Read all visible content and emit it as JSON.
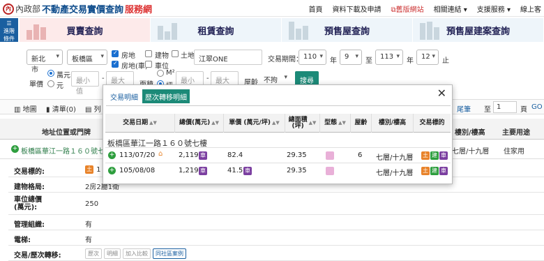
{
  "header": {
    "seal": "內",
    "ministry": "內政部",
    "title_part1": "不動產交易實價查詢",
    "title_part2": "服務網",
    "nav": [
      "首頁",
      "資料下載及申請",
      "舊版網站",
      "相關連結",
      "支援服務",
      "線上客"
    ]
  },
  "side_button": {
    "line1": "進階",
    "line2": "條件"
  },
  "tabs": [
    "買賣查詢",
    "租賃查詢",
    "預售屋查詢",
    "預售屋建案查詢"
  ],
  "search": {
    "city": "新北市",
    "district": "板橋區",
    "checkboxes": [
      {
        "label": "房地",
        "checked": true
      },
      {
        "label": "建物",
        "checked": false
      },
      {
        "label": "土地",
        "checked": false
      },
      {
        "label": "房地(車)",
        "checked": true
      },
      {
        "label": "車位",
        "checked": false
      }
    ],
    "keyword": "江翠ONE",
    "period_label": "交易期間：",
    "year_from": "110",
    "month_from": "9",
    "year_to": "113",
    "month_to": "12",
    "year_unit": "年",
    "to_label": "至",
    "end_label": "止",
    "price_label": "單價",
    "price_unit_options": [
      "萬元",
      "元"
    ],
    "min_placeholder": "最小值",
    "max_placeholder": "最大值",
    "area_label": "面積",
    "area_unit_options": [
      "M²",
      "坪"
    ],
    "age_label": "屋齡",
    "age_value": "不拘",
    "search_button": "搜尋"
  },
  "toolbar": {
    "map": "地圖",
    "list": "清單(0)",
    "print": "列",
    "last_page": "尾筆",
    "page_label": "至",
    "page_value": "1",
    "page_unit": "頁",
    "go": "GO"
  },
  "table": {
    "col_location": "地址位置或門牌",
    "col_floor": "樓別/樓高",
    "col_use": "主要用途",
    "row": {
      "address": "板橋區華江一路１６０號七樓",
      "floor": "七層/十九層",
      "use": "住家用"
    }
  },
  "detail": [
    {
      "k": "交易標的:",
      "v": "土 1"
    },
    {
      "k": "建物格局:",
      "v": "2房2廳1衛"
    },
    {
      "k": "車位總價\n(萬元):",
      "v": "250"
    },
    {
      "k": "管理組織:",
      "v": "有"
    },
    {
      "k": "電梯:",
      "v": "有"
    },
    {
      "k": "交易/歷次轉移:",
      "v": ""
    }
  ],
  "detail_buttons": [
    "歷次",
    "明細",
    "加入比較",
    "同社區案例"
  ],
  "modal": {
    "tabs": [
      "交易明細",
      "歷次轉移明細"
    ],
    "close": "✕",
    "headers": [
      "交易日期",
      "總價(萬元)",
      "單價 (萬元/坪)",
      "總面積\n(坪)",
      "型態",
      "屋齡",
      "樓別/樓高",
      "交易標的"
    ],
    "address": "板橋區華江一路１６０號七樓",
    "rows": [
      {
        "date": "113/07/20",
        "total": "2,119",
        "unit": "82.4",
        "area": "29.35",
        "age": "6",
        "floor": "七層/十九層"
      },
      {
        "date": "105/08/08",
        "total": "1,219",
        "unit": "41.5",
        "area": "29.35",
        "age": "",
        "floor": "七層/十九層"
      }
    ],
    "badge_labels": {
      "land": "土",
      "building": "建",
      "car": "車"
    }
  },
  "colors": {
    "brand_blue": "#0b4a8a",
    "accent_red": "#d33",
    "teal": "#1c8a78",
    "land": "#e8832a",
    "building": "#2e9e3e",
    "car": "#7b3fa0"
  }
}
